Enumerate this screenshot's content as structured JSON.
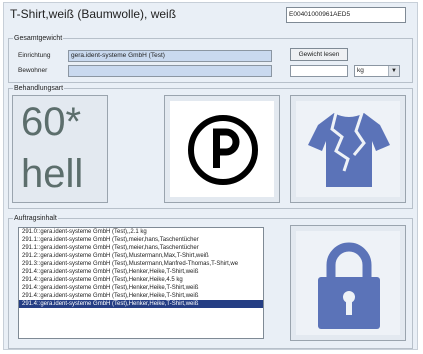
{
  "header": {
    "title": "T-Shirt,weiß (Baumwolle), weiß",
    "code": "E00401000961AED5"
  },
  "gesamtgewicht": {
    "legend": "Gesamtgewicht",
    "einrichtung_label": "Einrichtung",
    "einrichtung_value": "gera.ident-systeme GmbH (Test)",
    "bewohner_label": "Bewohner",
    "bewohner_value": "",
    "gewicht_lesen_label": "Gewicht lesen",
    "weight_value": "",
    "unit_selected": "kg"
  },
  "behandlungsart": {
    "legend": "Behandlungsart",
    "temperature": "60*",
    "shade": "hell",
    "icons": [
      "circled-p-icon",
      "torn-shirt-icon"
    ]
  },
  "auftragsinhalt": {
    "legend": "Auftragsinhalt",
    "items": [
      "291.0::gera.ident-systeme GmbH (Test),,2.1 kg",
      "291.1::gera.ident-systeme GmbH (Test),meier,hans,Taschentücher",
      "291.1::gera.ident-systeme GmbH (Test),meier,hans,Taschentücher",
      "291.2::gera.ident-systeme GmbH (Test),Mustermann,Max,T-Shirt,weiß",
      "291.3::gera.ident-systeme GmbH (Test),Mustermann,Manfred-Thomas,T-Shirt,we",
      "291.4::gera.ident-systeme GmbH (Test),Henker,Heike,T-Shirt,weiß",
      "291.4::gera.ident-systeme GmbH (Test),Henker,Heike,4.5 kg",
      "291.4::gera.ident-systeme GmbH (Test),Henker,Heike,T-Shirt,weiß",
      "291.4::gera.ident-systeme GmbH (Test),Henker,Heike,T-Shirt,weiß",
      "291.4::gera.ident-systeme GmbH (Test),Henker,Heike,T-Shirt,weiß"
    ],
    "selected_index": 9,
    "lock_icon": "padlock-icon"
  },
  "colors": {
    "accent": "#5b73b8",
    "selection": "#253e84",
    "background": "#e9eff6"
  }
}
